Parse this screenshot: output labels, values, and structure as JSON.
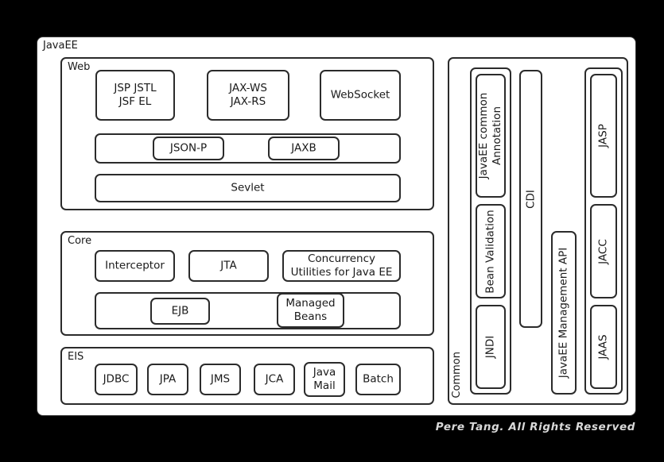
{
  "background_color": "#000000",
  "panel_color": "#ffffff",
  "stroke_color": "#2b2b2b",
  "text_color": "#1a1a1a",
  "footer_color": "#d8d8d8",
  "root": {
    "label": "JavaEE"
  },
  "web": {
    "label": "Web",
    "row1": [
      {
        "label": "JSP  JSTL\nJSF    EL"
      },
      {
        "label": "JAX-WS\nJAX-RS"
      },
      {
        "label": "WebSocket"
      }
    ],
    "row2": {
      "children": [
        {
          "label": "JSON-P"
        },
        {
          "label": "JAXB"
        }
      ]
    },
    "row3": {
      "label": "Sevlet"
    }
  },
  "core": {
    "label": "Core",
    "row1": [
      {
        "label": "Interceptor"
      },
      {
        "label": "JTA"
      },
      {
        "label": "Concurrency\nUtilities for Java EE"
      }
    ],
    "row2": {
      "children": [
        {
          "label": "EJB"
        },
        {
          "label": "Managed\nBeans"
        }
      ]
    }
  },
  "eis": {
    "label": "EIS",
    "items": [
      {
        "label": "JDBC"
      },
      {
        "label": "JPA"
      },
      {
        "label": "JMS"
      },
      {
        "label": "JCA"
      },
      {
        "label": "Java\nMail"
      },
      {
        "label": "Batch"
      }
    ]
  },
  "common": {
    "label": "Common",
    "column1": [
      {
        "label": "JavaEE common\nAnnotation"
      },
      {
        "label": "Bean Validation"
      },
      {
        "label": "JNDI"
      }
    ],
    "column2": [
      {
        "label": "CDI"
      }
    ],
    "column3": [
      {
        "label": "JavaEE Management API"
      }
    ],
    "column4": [
      {
        "label": "JASP"
      },
      {
        "label": "JACC"
      },
      {
        "label": "JAAS"
      }
    ]
  },
  "footer": {
    "credit": "Pere Tang. All Rights Reserved"
  }
}
